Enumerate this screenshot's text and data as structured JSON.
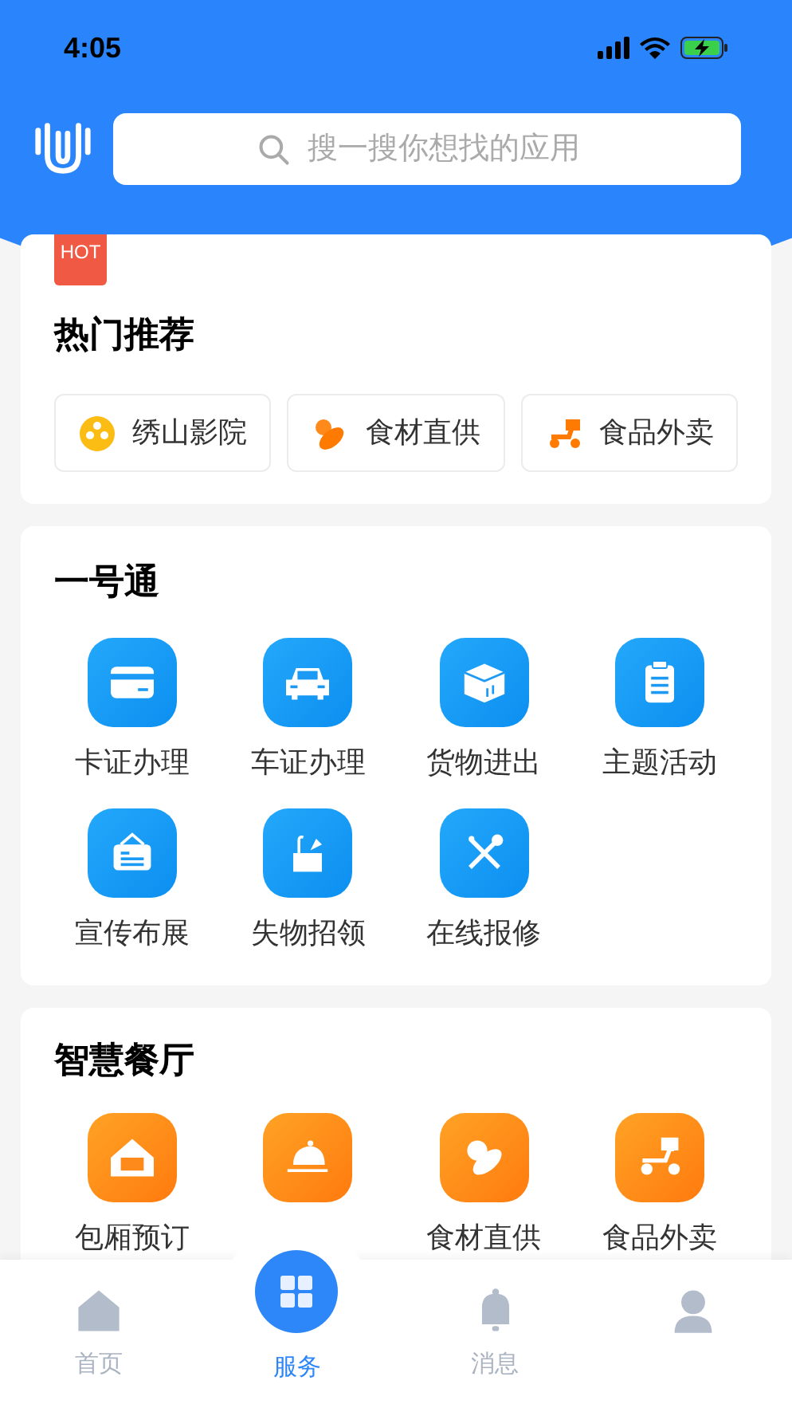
{
  "status_bar": {
    "time": "4:05"
  },
  "search": {
    "placeholder": "搜一搜你想找的应用"
  },
  "hot": {
    "badge": "HOT",
    "title": "热门推荐",
    "items": [
      {
        "label": "绣山影院"
      },
      {
        "label": "食材直供"
      },
      {
        "label": "食品外卖"
      }
    ]
  },
  "sections": [
    {
      "title": "一号通",
      "items": [
        {
          "label": "卡证办理"
        },
        {
          "label": "车证办理"
        },
        {
          "label": "货物进出"
        },
        {
          "label": "主题活动"
        },
        {
          "label": "宣传布展"
        },
        {
          "label": "失物招领"
        },
        {
          "label": "在线报修"
        }
      ]
    },
    {
      "title": "智慧餐厅",
      "items": [
        {
          "kind": "labeled",
          "label": "包厢预订"
        },
        {
          "kind": "icon_only"
        },
        {
          "kind": "labeled",
          "label": "食材直供"
        },
        {
          "kind": "labeled",
          "label": "食品外卖"
        }
      ]
    }
  ],
  "tabs": [
    {
      "label": "首页",
      "selected": false
    },
    {
      "label": "服务",
      "selected": true
    },
    {
      "label": "消息",
      "selected": false
    },
    {
      "selected": false
    }
  ]
}
